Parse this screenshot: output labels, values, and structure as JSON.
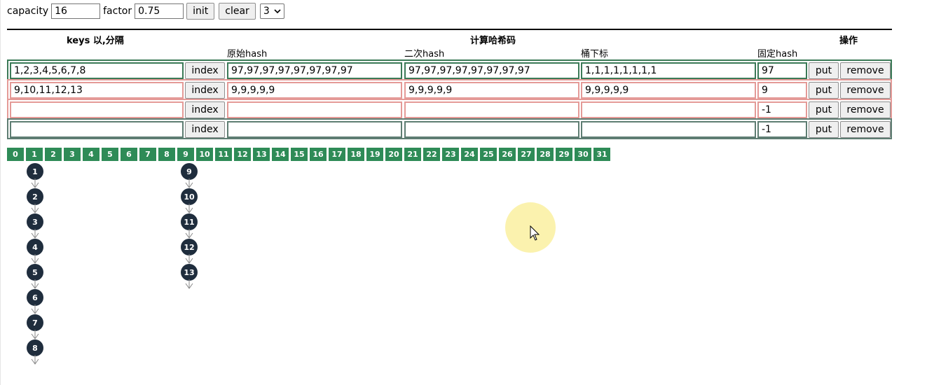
{
  "controls": {
    "capacity_label": "capacity",
    "capacity_value": "16",
    "factor_label": "factor",
    "factor_value": "0.75",
    "init_label": "init",
    "clear_label": "clear",
    "select_value": "3"
  },
  "table": {
    "header_keys": "keys 以,分隔",
    "header_compute": "计算哈希码",
    "header_ops": "操作",
    "sub_raw": "原始hash",
    "sub_second": "二次hash",
    "sub_bucket": "桶下标",
    "sub_fixed": "固定hash",
    "index_label": "index",
    "put_label": "put",
    "remove_label": "remove",
    "rows": [
      {
        "keys": "1,2,3,4,5,6,7,8",
        "raw": "97,97,97,97,97,97,97,97",
        "second": "97,97,97,97,97,97,97,97",
        "bucket": "1,1,1,1,1,1,1,1",
        "fixed": "97"
      },
      {
        "keys": "9,10,11,12,13",
        "raw": "9,9,9,9,9",
        "second": "9,9,9,9,9",
        "bucket": "9,9,9,9,9",
        "fixed": "9"
      },
      {
        "keys": "",
        "raw": "",
        "second": "",
        "bucket": "",
        "fixed": "-1"
      },
      {
        "keys": "",
        "raw": "",
        "second": "",
        "bucket": "",
        "fixed": "-1"
      }
    ]
  },
  "buckets": [
    "0",
    "1",
    "2",
    "3",
    "4",
    "5",
    "6",
    "7",
    "8",
    "9",
    "10",
    "11",
    "12",
    "13",
    "14",
    "15",
    "16",
    "17",
    "18",
    "19",
    "20",
    "21",
    "22",
    "23",
    "24",
    "25",
    "26",
    "27",
    "28",
    "29",
    "30",
    "31"
  ],
  "chains": [
    {
      "bucket": "1",
      "nodes": [
        "1",
        "2",
        "3",
        "4",
        "5",
        "6",
        "7",
        "8"
      ]
    },
    {
      "bucket": "9",
      "nodes": [
        "9",
        "10",
        "11",
        "12",
        "13"
      ]
    }
  ],
  "colors": {
    "bucket_bg": "#2e8b57",
    "node_bg": "#1f2d3d",
    "row_green": "#3b7a57",
    "row_red": "#e49a97"
  }
}
